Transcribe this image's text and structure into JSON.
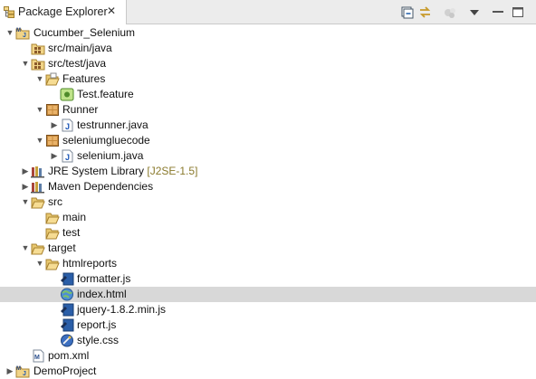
{
  "view": {
    "tab_title": "Package Explorer",
    "close_glyph": "✕"
  },
  "toolbar": {
    "icons": [
      "collapse-all-icon",
      "link-with-editor-icon",
      "focus-on-active-task-icon",
      "view-menu-icon",
      "minimize-icon",
      "maximize-icon"
    ]
  },
  "tree": {
    "rows": [
      {
        "label": "Cucumber_Selenium",
        "icon": "maven-project",
        "twisty": "open"
      },
      {
        "label": "src/main/java",
        "icon": "source-folder",
        "twisty": "none"
      },
      {
        "label": "src/test/java",
        "icon": "source-folder",
        "twisty": "open"
      },
      {
        "label": "Features",
        "icon": "folder-open",
        "twisty": "open"
      },
      {
        "label": "Test.feature",
        "icon": "feature-file",
        "twisty": "none"
      },
      {
        "label": "Runner",
        "icon": "package",
        "twisty": "open"
      },
      {
        "label": "testrunner.java",
        "icon": "java-file",
        "twisty": "closed"
      },
      {
        "label": "seleniumgluecode",
        "icon": "package",
        "twisty": "open"
      },
      {
        "label": "selenium.java",
        "icon": "java-file",
        "twisty": "closed"
      },
      {
        "label": "JRE System Library",
        "decoration": "[J2SE-1.5]",
        "icon": "library",
        "twisty": "closed"
      },
      {
        "label": "Maven Dependencies",
        "icon": "library",
        "twisty": "closed"
      },
      {
        "label": "src",
        "icon": "folder-open",
        "twisty": "open"
      },
      {
        "label": "main",
        "icon": "folder-open",
        "twisty": "none"
      },
      {
        "label": "test",
        "icon": "folder-open",
        "twisty": "none"
      },
      {
        "label": "target",
        "icon": "folder-open",
        "twisty": "open"
      },
      {
        "label": "htmlreports",
        "icon": "folder-open",
        "twisty": "open"
      },
      {
        "label": "formatter.js",
        "icon": "js-file",
        "twisty": "none"
      },
      {
        "label": "index.html",
        "icon": "html-file",
        "twisty": "none",
        "selected": true
      },
      {
        "label": "jquery-1.8.2.min.js",
        "icon": "js-file",
        "twisty": "none"
      },
      {
        "label": "report.js",
        "icon": "js-file",
        "twisty": "none"
      },
      {
        "label": "style.css",
        "icon": "css-file",
        "twisty": "none"
      },
      {
        "label": "pom.xml",
        "icon": "xml-file",
        "twisty": "none"
      },
      {
        "label": "DemoProject",
        "icon": "maven-project",
        "twisty": "closed"
      }
    ]
  }
}
